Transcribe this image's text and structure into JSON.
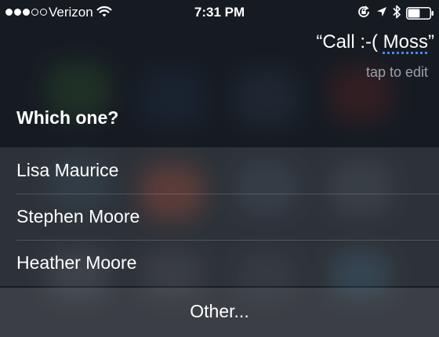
{
  "status_bar": {
    "carrier": "Verizon",
    "signal_bars_filled": 3,
    "signal_bars_total": 5,
    "time": "7:31 PM",
    "icons": [
      "wifi-icon",
      "rotation-lock-icon",
      "location-arrow-icon",
      "bluetooth-icon",
      "battery-icon"
    ],
    "battery_level": 0.55
  },
  "siri": {
    "query_prefix": "“Call :-( ",
    "query_name": "Moss",
    "query_suffix": "”",
    "tap_to_edit": "tap to edit",
    "question": "Which one?",
    "choices": [
      {
        "label": "Lisa Maurice"
      },
      {
        "label": "Stephen Moore"
      },
      {
        "label": "Heather Moore"
      }
    ],
    "other_label": "Other..."
  },
  "colors": {
    "text": "#ffffff",
    "secondary_text": "#9aa1a8",
    "underline_accent": "#3f8cff"
  }
}
